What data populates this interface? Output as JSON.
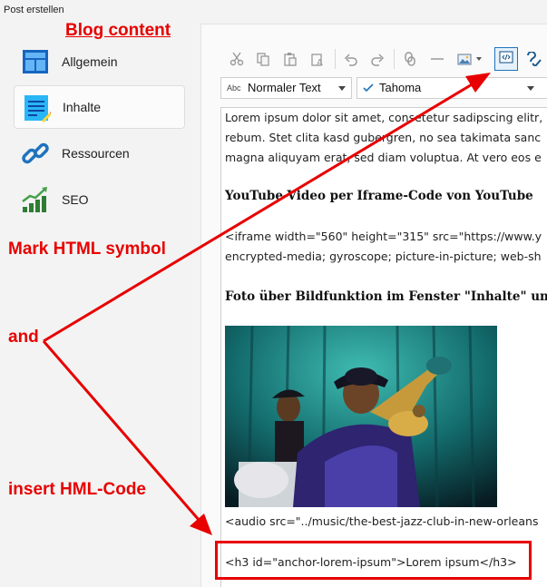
{
  "window": {
    "title": "Post erstellen"
  },
  "annotations": {
    "blog_content": "Blog content",
    "mark_html": "Mark HTML symbol",
    "and": "and",
    "insert_html": "insert HML-Code"
  },
  "sidebar": {
    "items": [
      {
        "label": "Allgemein",
        "icon": "layout-icon",
        "active": false
      },
      {
        "label": "Inhalte",
        "icon": "document-edit-icon",
        "active": true
      },
      {
        "label": "Ressourcen",
        "icon": "link-icon",
        "active": false
      },
      {
        "label": "SEO",
        "icon": "chart-growth-icon",
        "active": false
      }
    ]
  },
  "toolbar": {
    "buttons": [
      "cut-icon",
      "copy-icon",
      "paste-icon",
      "paste-text-icon",
      "undo-icon",
      "redo-icon",
      "link-icon",
      "horizontal-line-icon",
      "image-icon",
      "source-code-icon",
      "spellcheck-icon"
    ],
    "style_prefix": "Abc",
    "style_select": "Normaler Text",
    "font_select": "Tahoma"
  },
  "editor": {
    "line1": "Lorem ipsum dolor sit amet, consetetur sadipscing elitr,",
    "line2": "rebum. Stet clita kasd gubergren, no sea takimata sanc",
    "line3": "magna aliquyam erat, sed diam voluptua. At vero eos e",
    "heading1": "YouTube-Video per Iframe-Code von YouTube",
    "iframe1": "<iframe width=\"560\" height=\"315\" src=\"https://www.y",
    "iframe2": "encrypted-media; gyroscope; picture-in-picture; web-sh",
    "heading2": "Foto über Bildfunktion im Fenster \"Inhalte\" und",
    "audio": "<audio src=\"../music/the-best-jazz-club-in-new-orleans",
    "h3code": "<h3 id=\"anchor-lorem-ipsum\">Lorem ipsum</h3>"
  },
  "colors": {
    "annotation": "#e80000",
    "accent": "#1e73be"
  }
}
